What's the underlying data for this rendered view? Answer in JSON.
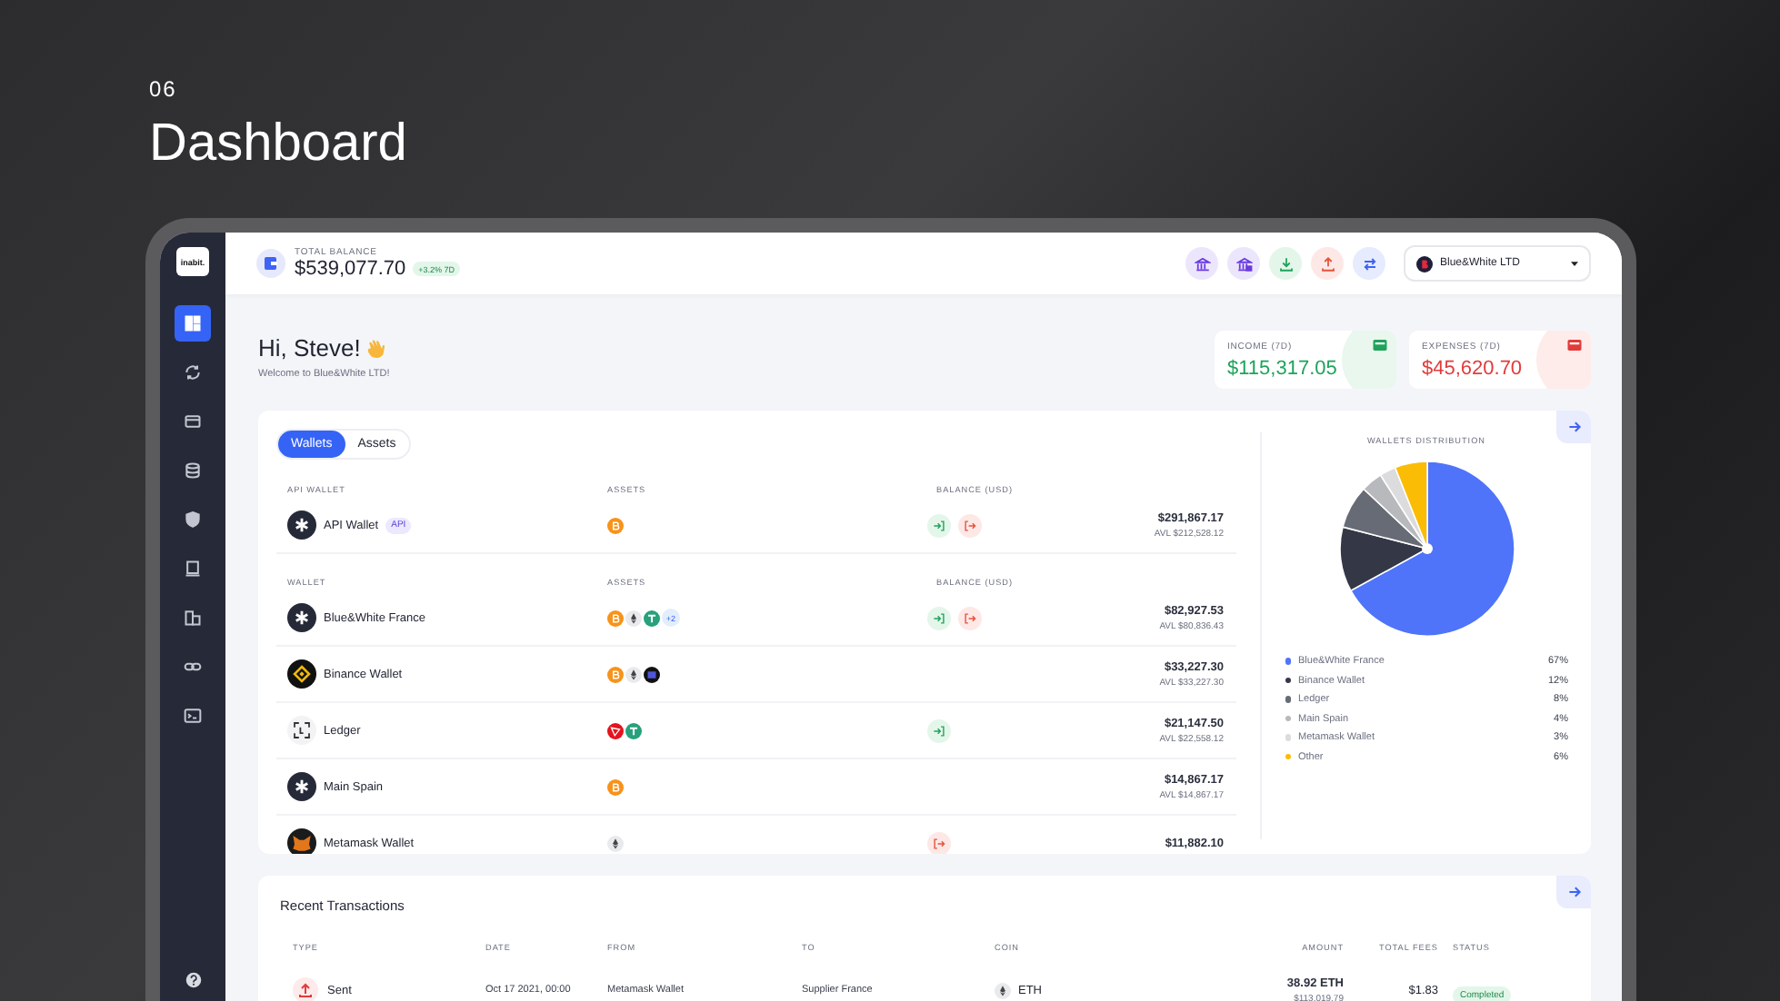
{
  "slide": {
    "number": "06",
    "title": "Dashboard"
  },
  "app": {
    "logo": "inabit."
  },
  "sidebar": {
    "items": [
      {
        "selected": true
      },
      {
        "selected": false
      },
      {
        "selected": false
      },
      {
        "selected": false
      },
      {
        "selected": false
      },
      {
        "selected": false
      },
      {
        "selected": false
      },
      {
        "selected": false
      },
      {
        "selected": false
      }
    ]
  },
  "topbar": {
    "total_balance": {
      "label": "TOTAL BALANCE",
      "value": "$539,077.70",
      "change": "+3.2% 7D"
    },
    "actions": [
      {
        "kind": "bank"
      },
      {
        "kind": "bank-lock"
      },
      {
        "kind": "deposit"
      },
      {
        "kind": "withdraw"
      },
      {
        "kind": "swap"
      }
    ],
    "company": "Blue&White LTD"
  },
  "greeting": {
    "title": "Hi, Steve!",
    "subtitle": "Welcome to Blue&White LTD!"
  },
  "stats": [
    {
      "kind": "income",
      "label": "INCOME (7D)",
      "value": "$115,317.05"
    },
    {
      "kind": "expense",
      "label": "EXPENSES (7D)",
      "value": "$45,620.70"
    }
  ],
  "wallets_card": {
    "tabs": [
      {
        "label": "Wallets",
        "selected": true
      },
      {
        "label": "Assets",
        "selected": false
      }
    ],
    "sections": [
      {
        "columns": [
          "API WALLET",
          "ASSETS",
          "BALANCE (USD)"
        ],
        "rows": [
          {
            "kind": "asterisk",
            "name": "API Wallet",
            "badge": "API",
            "assets": [
              {
                "kind": "btc"
              }
            ],
            "deposit": true,
            "withdraw": true,
            "balance": "$291,867.17",
            "available": "AVL $212,528.12"
          }
        ]
      },
      {
        "columns": [
          "WALLET",
          "ASSETS",
          "BALANCE (USD)"
        ],
        "rows": [
          {
            "kind": "asterisk",
            "name": "Blue&White France",
            "assets": [
              {
                "kind": "btc"
              },
              {
                "kind": "eth"
              },
              {
                "kind": "usdt"
              },
              {
                "kind": "more",
                "label": "+2"
              }
            ],
            "deposit": true,
            "withdraw": true,
            "balance": "$82,927.53",
            "available": "AVL $80,836.43"
          },
          {
            "kind": "binance",
            "name": "Binance Wallet",
            "assets": [
              {
                "kind": "btc"
              },
              {
                "kind": "eth"
              },
              {
                "kind": "dark"
              }
            ],
            "deposit": false,
            "withdraw": false,
            "balance": "$33,227.30",
            "available": "AVL $33,227.30"
          },
          {
            "kind": "ledger",
            "name": "Ledger",
            "assets": [
              {
                "kind": "tron"
              },
              {
                "kind": "usdt"
              }
            ],
            "deposit": true,
            "withdraw": false,
            "balance": "$21,147.50",
            "available": "AVL $22,558.12"
          },
          {
            "kind": "asterisk",
            "name": "Main Spain",
            "assets": [
              {
                "kind": "btc"
              }
            ],
            "deposit": false,
            "withdraw": false,
            "balance": "$14,867.17",
            "available": "AVL $14,867.17"
          },
          {
            "kind": "metamask",
            "name": "Metamask Wallet",
            "assets": [
              {
                "kind": "eth"
              }
            ],
            "deposit": false,
            "withdraw": true,
            "balance": "$11,882.10"
          }
        ]
      }
    ],
    "distribution": {
      "chart_data": {
        "type": "pie",
        "title": "WALLETS DISTRIBUTION",
        "categories": [
          "Blue&White France",
          "Binance Wallet",
          "Ledger",
          "Main Spain",
          "Metamask Wallet",
          "Other"
        ],
        "series": [
          {
            "values": [
              67,
              12,
              8,
              4,
              3,
              6
            ]
          }
        ]
      },
      "legend": [
        {
          "value": "67%",
          "color": "#4f74f9"
        },
        {
          "value": "12%",
          "color": "#343846"
        },
        {
          "value": "8%",
          "color": "#676b75"
        },
        {
          "value": "4%",
          "color": "#b8b9bd"
        },
        {
          "value": "3%",
          "color": "#dcdcdf"
        },
        {
          "value": "6%",
          "color": "#fbbc05"
        }
      ]
    }
  },
  "transactions": {
    "title": "Recent Transactions",
    "columns": [
      "TYPE",
      "DATE",
      "FROM",
      "TO",
      "COIN",
      "AMOUNT",
      "TOTAL FEES",
      "STATUS"
    ],
    "rows": [
      {
        "kind": "sent",
        "type": "Sent",
        "date": "Oct 17 2021, 00:00",
        "from": "Metamask Wallet",
        "to": "Supplier France",
        "coin": {
          "kind": "eth",
          "label": "ETH"
        },
        "amount": "38.92 ETH",
        "amount_usd": "$113,019.79",
        "fees": "$1.83",
        "status": "Completed"
      }
    ]
  }
}
